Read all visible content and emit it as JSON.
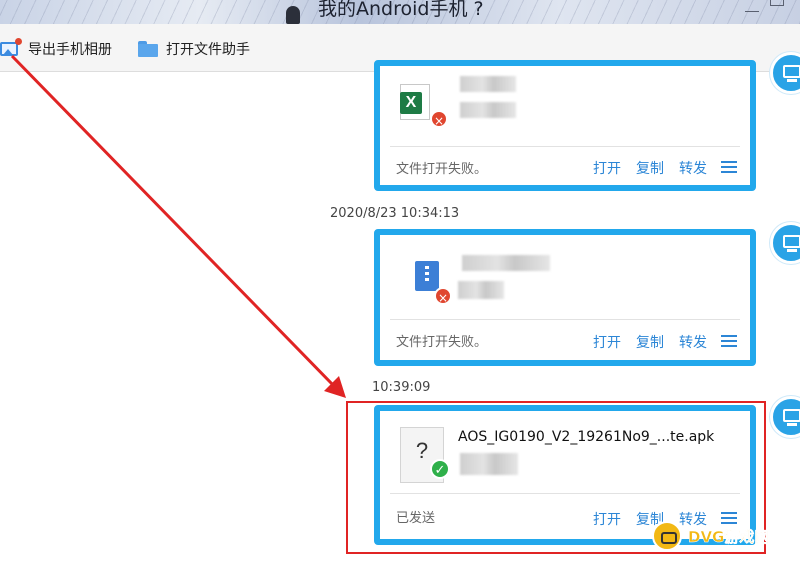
{
  "window": {
    "title": "我的Android手机 ?"
  },
  "toolbar": {
    "export_label": "导出手机相册",
    "open_label": "打开文件助手"
  },
  "messages": [
    {
      "timestamp": "",
      "file_type": "excel",
      "file_letter": "X",
      "status": "文件打开失败。",
      "state": "failed"
    },
    {
      "timestamp": "2020/8/23 10:34:13",
      "file_type": "archive",
      "status": "文件打开失败。",
      "state": "failed"
    },
    {
      "timestamp": "10:39:09",
      "file_type": "apk",
      "file_name": "AOS_IG0190_V2_19261No9_...te.apk",
      "unknown_glyph": "?",
      "status": "已发送",
      "state": "sent"
    }
  ],
  "actions": {
    "open": "打开",
    "copy": "复制",
    "forward": "转发"
  },
  "glyphs": {
    "x": "×",
    "check": "✓"
  },
  "watermark": {
    "text": "DVG游戏网"
  },
  "colors": {
    "accent": "#22a8ec",
    "link": "#2c86d6",
    "error": "#e0462f",
    "success": "#2fb04a",
    "annotation": "#e02424"
  }
}
